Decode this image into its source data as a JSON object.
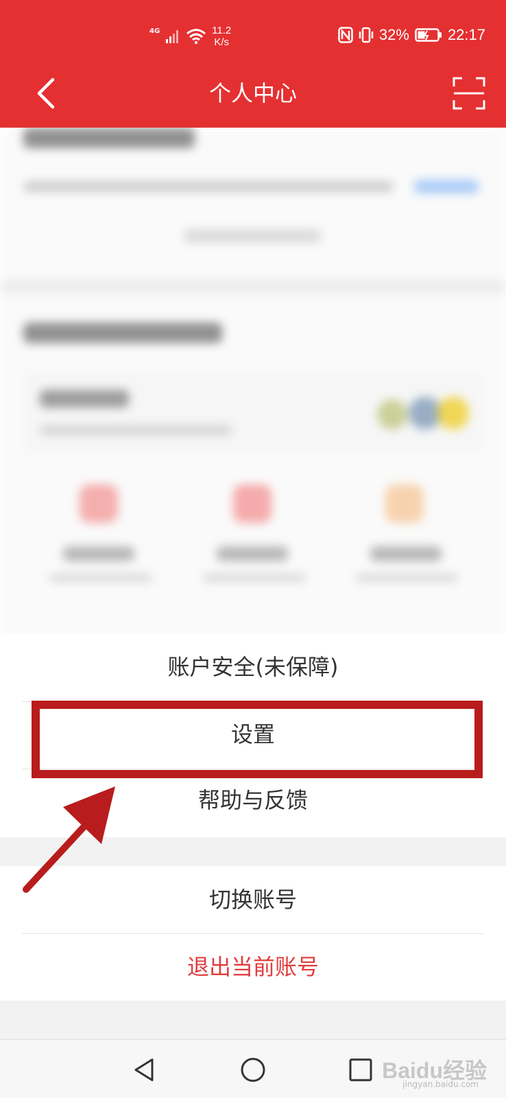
{
  "status_bar": {
    "network": "4G",
    "speed_value": "11.2",
    "speed_unit": "K/s",
    "battery": "32%",
    "time": "22:17"
  },
  "navbar": {
    "title": "个人中心",
    "back_icon": "chevron-left-icon",
    "scan_icon": "scan-icon"
  },
  "menu": {
    "group1": [
      {
        "label": "账户安全(未保障)"
      },
      {
        "label": "设置"
      },
      {
        "label": "帮助与反馈"
      }
    ],
    "group2": [
      {
        "label": "切换账号"
      },
      {
        "label": "退出当前账号"
      }
    ]
  },
  "bottom_nav": {
    "back_icon": "triangle-back-icon",
    "home_icon": "circle-home-icon",
    "recent_icon": "square-recent-icon"
  },
  "watermark": {
    "text": "Baidu经验",
    "sub": "jingyan.baidu.com"
  },
  "colors": {
    "brand_red": "#e53032",
    "danger_text": "#e03c3c",
    "annotation": "#b91c1c"
  }
}
